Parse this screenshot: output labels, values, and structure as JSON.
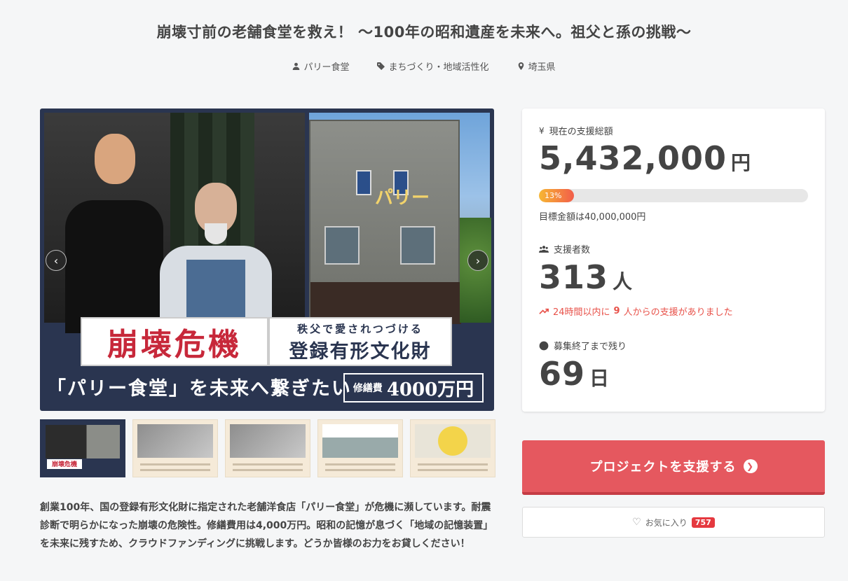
{
  "project": {
    "title": "崩壊寸前の老舗食堂を救え！ ～100年の昭和遺産を未来へ。祖父と孫の挑戦～",
    "owner": "パリー食堂",
    "category": "まちづくり・地域活性化",
    "location": "埼玉県",
    "description": "創業100年、国の登録有形文化財に指定された老舗洋食店「パリー食堂」が危機に瀕しています。耐震診断で明らかになった崩壊の危険性。修繕費用は4,000万円。昭和の記憶が息づく「地域の記憶装置」を未来に残すため、クラウドファンディングに挑戦します。どうか皆様のお力をお貸しください！"
  },
  "hero": {
    "crisis": "崩壊危機",
    "sub": "秩父で愛されつづける",
    "heritage": "登録有形文化財",
    "sign": "パリー",
    "tagline": "「パリー食堂」を未来へ繋ぎたい",
    "cost_label": "修繕費",
    "cost_value": "4000万円",
    "prev": "‹",
    "next": "›"
  },
  "thumbnails": {
    "count": 5,
    "active_index": 0,
    "active_caption": "崩壊危機"
  },
  "stats": {
    "funded_label": "現在の支援総額",
    "funded_value": "5,432,000",
    "funded_unit": "円",
    "progress_percent": 13,
    "progress_label": "13%",
    "goal_text": "目標金額は40,000,000円",
    "backers_label": "支援者数",
    "backers_value": "313",
    "backers_unit": "人",
    "recent_prefix": "24時間以内に",
    "recent_count": "9",
    "recent_suffix": "人からの支援がありました",
    "remaining_label": "募集終了まで残り",
    "remaining_value": "69",
    "remaining_unit": "日"
  },
  "actions": {
    "support_label": "プロジェクトを支援する",
    "favorite_label": "お気に入り",
    "favorite_count": "757"
  },
  "colors": {
    "accent": "#e5585f",
    "hero_bg": "#2a3550",
    "crisis_red": "#c7283a",
    "trend_red": "#e8524a"
  }
}
